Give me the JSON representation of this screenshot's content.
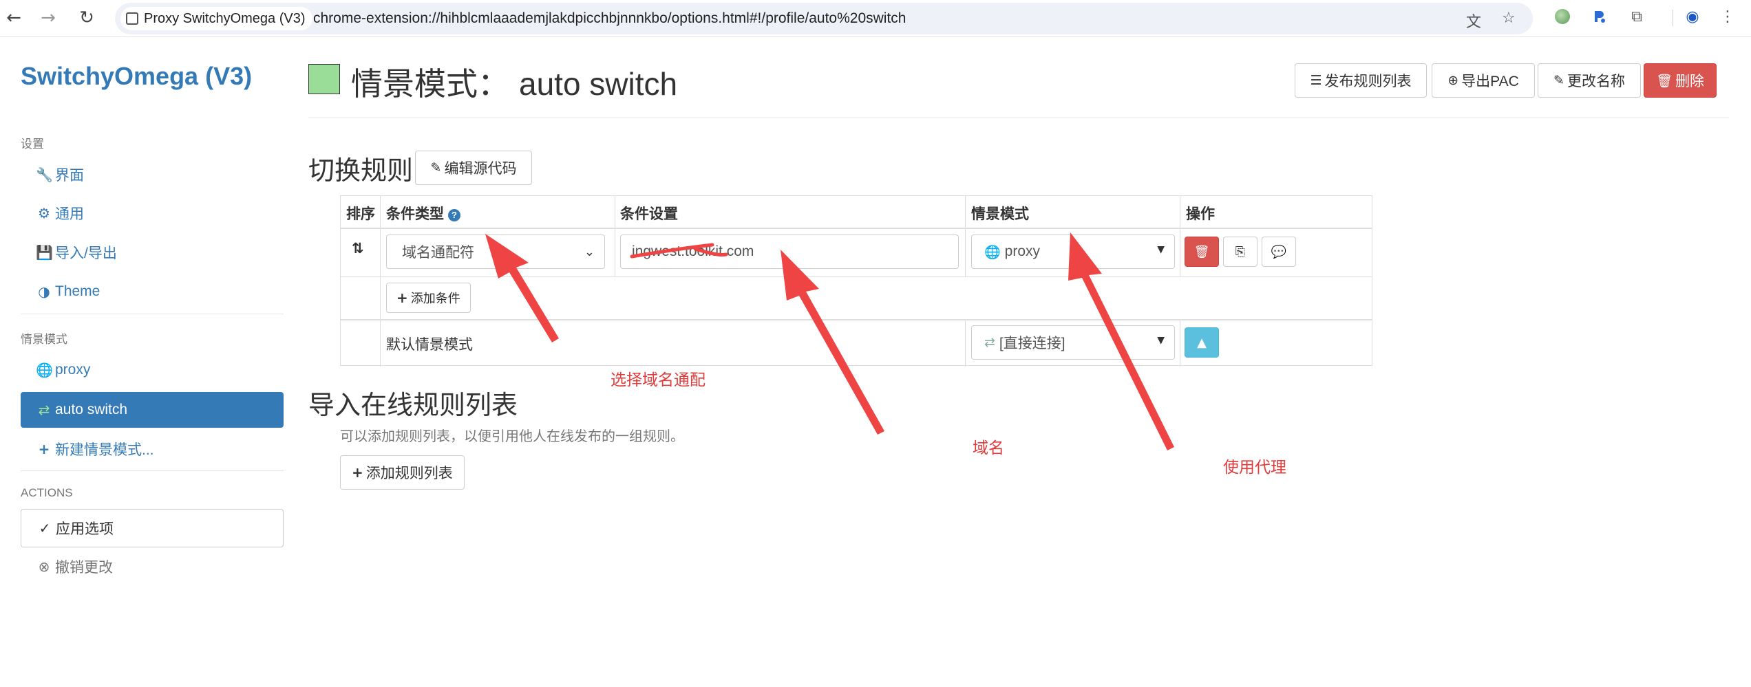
{
  "browser": {
    "tab_title": "Proxy SwitchyOmega (V3)",
    "url": "chrome-extension://hihblcmlaaademjlakdpicchbjnnnkbo/options.html#!/profile/auto%20switch",
    "back_icon": "←",
    "forward_icon": "→",
    "reload_icon": "↻",
    "translate_icon": "⽂",
    "star_icon": "☆",
    "extensions_icon": "⧉",
    "profile_icon": "◉",
    "menu_icon": "⋮"
  },
  "sidebar": {
    "brand": "SwitchyOmega (V3)",
    "settings_header": "设置",
    "settings_items": [
      {
        "icon": "🔧",
        "label": "界面"
      },
      {
        "icon": "⚙",
        "label": "通用"
      },
      {
        "icon": "💾",
        "label": "导入/导出"
      },
      {
        "icon": "◑",
        "label": "Theme"
      }
    ],
    "profiles_header": "情景模式",
    "profile_items": [
      {
        "icon": "🌐",
        "label": "proxy"
      },
      {
        "icon": "⇄",
        "label": "auto switch"
      },
      {
        "icon": "+",
        "label": "新建情景模式..."
      }
    ],
    "actions_header": "ACTIONS",
    "apply": {
      "icon": "✓",
      "label": "应用选项"
    },
    "undo": {
      "icon": "⊗",
      "label": "撤销更改"
    }
  },
  "header": {
    "title_prefix": "情景模式：",
    "profile_name": "auto switch",
    "swatch_color": "#99dd99",
    "buttons": [
      {
        "icon": "☰",
        "label": "发布规则列表"
      },
      {
        "icon": "⊕",
        "label": "导出PAC"
      },
      {
        "icon": "✎",
        "label": "更改名称"
      },
      {
        "icon": "🗑",
        "label": "删除"
      }
    ]
  },
  "switch_rules": {
    "title": "切换规则",
    "edit_source_button": {
      "icon": "✎",
      "label": "编辑源代码"
    },
    "columns": [
      "排序",
      "条件类型",
      "条件设置",
      "情景模式",
      "操作"
    ],
    "rule": {
      "sort_icon": "⇅",
      "condition_type": "域名通配符",
      "condition_value": "ingwest.toolkit.com",
      "profile_icon": "🌐",
      "profile": "proxy",
      "action_icons": [
        "🗑",
        "⎘",
        "💬"
      ]
    },
    "add_condition": {
      "icon": "+",
      "label": "添加条件"
    },
    "default_label": "默认情景模式",
    "default_profile_icon": "⇄",
    "default_profile": "[直接连接]",
    "default_action_icon": "▲"
  },
  "online_rules": {
    "title": "导入在线规则列表",
    "help": "可以添加规则列表，以便引用他人在线发布的一组规则。",
    "add_button": {
      "icon": "+",
      "label": "添加规则列表"
    }
  },
  "annotations": [
    {
      "text": "选择域名通配"
    },
    {
      "text": "域名"
    },
    {
      "text": "使用代理"
    }
  ],
  "colors": {
    "primary": "#337ab7",
    "danger": "#d9534f",
    "info": "#5bc0de",
    "annotation": "#e23b3b"
  }
}
